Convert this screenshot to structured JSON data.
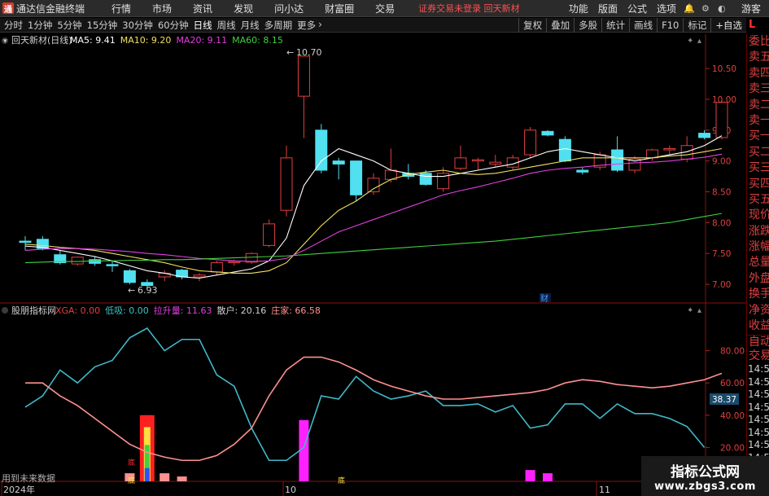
{
  "app": {
    "title": "通达信金融终端",
    "logo_text": "通"
  },
  "menu": [
    "行情",
    "市场",
    "资讯",
    "发现",
    "问小达",
    "财富圈",
    "交易"
  ],
  "notice": "证券交易未登录  回天新材",
  "top_right": {
    "items": [
      "功能",
      "版面",
      "公式",
      "选项"
    ],
    "guest": "游客"
  },
  "periods": [
    "分时",
    "1分钟",
    "5分钟",
    "15分钟",
    "30分钟",
    "60分钟",
    "日线",
    "周线",
    "月线",
    "多周期",
    "更多"
  ],
  "active_period": "日线",
  "toolbar": [
    "复权",
    "叠加",
    "多股",
    "统计",
    "画线",
    "F10",
    "标记",
    "+自选"
  ],
  "L_mark": "L",
  "sidebar": {
    "items": [
      "委比",
      "卖五",
      "卖四",
      "卖三",
      "卖二",
      "卖一",
      "买一",
      "买二",
      "买三",
      "买四",
      "买五",
      "现价",
      "涨跌",
      "涨幅",
      "总量",
      "外盘",
      "换手",
      "净资",
      "收益"
    ],
    "auto": [
      "自动",
      "交易"
    ],
    "times": [
      "14:56",
      "14:56",
      "14:56",
      "14:56",
      "14:56",
      "14:56",
      "14:56",
      "14:56",
      "14:56",
      "14:56"
    ]
  },
  "main_panel": {
    "title": "回天新材(日线)",
    "ma": [
      {
        "label": "MA5: 9.41",
        "color": "#ffffff"
      },
      {
        "label": "MA10: 9.20",
        "color": "#f0e060"
      },
      {
        "label": "MA20: 9.11",
        "color": "#e040e0"
      },
      {
        "label": "MA60: 8.15",
        "color": "#40d040"
      }
    ],
    "high_label": "10.70",
    "low_label": "6.93",
    "finance_marker": "财"
  },
  "sub_panel": {
    "title": "股朋指标网",
    "values": [
      {
        "label": "XGA: 0.00",
        "color": "#e04040"
      },
      {
        "label": "低吸: 0.00",
        "color": "#40c0c0"
      },
      {
        "label": "拉升量: 11.63",
        "color": "#e040e0"
      },
      {
        "label": "散户: 20.16",
        "color": "#d0d0d0"
      },
      {
        "label": "庄家: 66.58",
        "color": "#ff9090"
      }
    ],
    "current_value_tag": "38.37",
    "future_data_note": "用到未来数据",
    "markers": [
      "底",
      "底",
      "底"
    ]
  },
  "x_axis": {
    "labels": [
      "2024年",
      "10",
      "11"
    ]
  },
  "watermark": {
    "line1": "指标公式网",
    "line2": "www.zbgs3.com"
  },
  "chart_data": [
    {
      "type": "candlestick",
      "title": "回天新材(日线)",
      "ylim": [
        6.75,
        10.95
      ],
      "yticks": [
        7.0,
        7.5,
        8.0,
        8.5,
        9.0,
        9.5,
        10.0,
        10.5
      ],
      "up_color": "#e04040",
      "down_color": "#50e0f0",
      "candles": [
        {
          "o": 7.7,
          "h": 7.78,
          "l": 7.55,
          "c": 7.68
        },
        {
          "o": 7.73,
          "h": 7.78,
          "l": 7.55,
          "c": 7.58
        },
        {
          "o": 7.48,
          "h": 7.55,
          "l": 7.32,
          "c": 7.35
        },
        {
          "o": 7.33,
          "h": 7.45,
          "l": 7.3,
          "c": 7.44
        },
        {
          "o": 7.4,
          "h": 7.46,
          "l": 7.3,
          "c": 7.34
        },
        {
          "o": 7.32,
          "h": 7.38,
          "l": 7.2,
          "c": 7.3
        },
        {
          "o": 7.22,
          "h": 7.25,
          "l": 7.0,
          "c": 7.03
        },
        {
          "o": 7.03,
          "h": 7.08,
          "l": 6.93,
          "c": 6.98
        },
        {
          "o": 7.12,
          "h": 7.23,
          "l": 7.05,
          "c": 7.18
        },
        {
          "o": 7.23,
          "h": 7.25,
          "l": 7.08,
          "c": 7.12
        },
        {
          "o": 7.12,
          "h": 7.18,
          "l": 7.05,
          "c": 7.15
        },
        {
          "o": 7.2,
          "h": 7.38,
          "l": 7.15,
          "c": 7.35
        },
        {
          "o": 7.35,
          "h": 7.4,
          "l": 7.3,
          "c": 7.37
        },
        {
          "o": 7.36,
          "h": 7.52,
          "l": 7.33,
          "c": 7.5
        },
        {
          "o": 7.63,
          "h": 8.05,
          "l": 7.6,
          "c": 7.98
        },
        {
          "o": 8.2,
          "h": 9.25,
          "l": 8.1,
          "c": 9.05
        },
        {
          "o": 10.05,
          "h": 10.7,
          "l": 9.37,
          "c": 10.7
        },
        {
          "o": 9.5,
          "h": 9.6,
          "l": 8.8,
          "c": 8.85
        },
        {
          "o": 9.0,
          "h": 9.05,
          "l": 8.7,
          "c": 8.95
        },
        {
          "o": 9.0,
          "h": 9.0,
          "l": 8.35,
          "c": 8.45
        },
        {
          "o": 8.5,
          "h": 8.8,
          "l": 8.45,
          "c": 8.72
        },
        {
          "o": 8.7,
          "h": 9.2,
          "l": 8.65,
          "c": 8.85
        },
        {
          "o": 8.8,
          "h": 8.95,
          "l": 8.7,
          "c": 8.75
        },
        {
          "o": 8.8,
          "h": 8.85,
          "l": 8.6,
          "c": 8.62
        },
        {
          "o": 8.55,
          "h": 8.9,
          "l": 8.5,
          "c": 8.8
        },
        {
          "o": 8.88,
          "h": 9.25,
          "l": 8.85,
          "c": 9.05
        },
        {
          "o": 9.0,
          "h": 9.05,
          "l": 8.85,
          "c": 9.02
        },
        {
          "o": 8.95,
          "h": 9.1,
          "l": 8.9,
          "c": 8.98
        },
        {
          "o": 8.9,
          "h": 9.1,
          "l": 8.85,
          "c": 9.05
        },
        {
          "o": 9.1,
          "h": 9.55,
          "l": 9.05,
          "c": 9.5
        },
        {
          "o": 9.48,
          "h": 9.5,
          "l": 9.4,
          "c": 9.42
        },
        {
          "o": 9.35,
          "h": 9.4,
          "l": 8.98,
          "c": 9.0
        },
        {
          "o": 8.85,
          "h": 8.9,
          "l": 8.78,
          "c": 8.82
        },
        {
          "o": 8.9,
          "h": 9.15,
          "l": 8.85,
          "c": 9.1
        },
        {
          "o": 9.18,
          "h": 9.4,
          "l": 8.82,
          "c": 8.85
        },
        {
          "o": 8.85,
          "h": 9.08,
          "l": 8.8,
          "c": 9.03
        },
        {
          "o": 9.05,
          "h": 9.2,
          "l": 9.0,
          "c": 9.18
        },
        {
          "o": 9.18,
          "h": 9.25,
          "l": 9.1,
          "c": 9.2
        },
        {
          "o": 9.03,
          "h": 9.4,
          "l": 8.98,
          "c": 9.25
        },
        {
          "o": 9.45,
          "h": 9.5,
          "l": 9.35,
          "c": 9.38
        },
        {
          "o": 9.38,
          "h": 10.0,
          "l": 9.35,
          "c": 9.95
        }
      ],
      "ma_series": [
        {
          "name": "MA5",
          "color": "#ffffff",
          "values": [
            7.62,
            7.6,
            7.55,
            7.5,
            7.45,
            7.38,
            7.3,
            7.22,
            7.18,
            7.12,
            7.1,
            7.15,
            7.2,
            7.25,
            7.38,
            7.75,
            8.6,
            9.0,
            9.2,
            9.1,
            9.0,
            8.85,
            8.8,
            8.75,
            8.75,
            8.8,
            8.85,
            8.9,
            8.95,
            9.05,
            9.15,
            9.2,
            9.15,
            9.1,
            9.05,
            9.0,
            9.05,
            9.1,
            9.15,
            9.25,
            9.41
          ]
        },
        {
          "name": "MA10",
          "color": "#f0e060",
          "values": [
            7.65,
            7.63,
            7.6,
            7.58,
            7.55,
            7.5,
            7.45,
            7.4,
            7.35,
            7.28,
            7.22,
            7.2,
            7.18,
            7.18,
            7.22,
            7.35,
            7.65,
            7.95,
            8.2,
            8.35,
            8.55,
            8.7,
            8.78,
            8.82,
            8.85,
            8.8,
            8.78,
            8.8,
            8.85,
            8.9,
            8.95,
            9.0,
            9.05,
            9.05,
            9.05,
            9.05,
            9.05,
            9.08,
            9.1,
            9.15,
            9.2
          ]
        },
        {
          "name": "MA20",
          "color": "#e040e0",
          "values": [
            7.55,
            7.57,
            7.58,
            7.58,
            7.57,
            7.55,
            7.53,
            7.5,
            7.48,
            7.45,
            7.42,
            7.4,
            7.38,
            7.37,
            7.38,
            7.42,
            7.55,
            7.7,
            7.85,
            7.95,
            8.05,
            8.15,
            8.25,
            8.35,
            8.45,
            8.52,
            8.58,
            8.65,
            8.72,
            8.8,
            8.85,
            8.88,
            8.9,
            8.93,
            8.95,
            8.97,
            8.98,
            9.0,
            9.03,
            9.06,
            9.11
          ]
        },
        {
          "name": "MA60",
          "color": "#40d040",
          "values": [
            7.35,
            7.36,
            7.37,
            7.37,
            7.38,
            7.38,
            7.39,
            7.39,
            7.4,
            7.4,
            7.41,
            7.42,
            7.43,
            7.44,
            7.45,
            7.46,
            7.48,
            7.5,
            7.52,
            7.54,
            7.56,
            7.58,
            7.6,
            7.62,
            7.64,
            7.66,
            7.68,
            7.7,
            7.73,
            7.76,
            7.79,
            7.82,
            7.85,
            7.88,
            7.91,
            7.94,
            7.97,
            8.0,
            8.05,
            8.1,
            8.15
          ]
        }
      ]
    },
    {
      "type": "line",
      "title": "股朋指标网",
      "ylim": [
        0,
        100
      ],
      "yticks": [
        20.0,
        40.0,
        60.0,
        80.0
      ],
      "series": [
        {
          "name": "散户",
          "color": "#40b8c8",
          "values": [
            45,
            52,
            68,
            60,
            70,
            74,
            88,
            94,
            80,
            87,
            87,
            65,
            58,
            32,
            12,
            12,
            20,
            52,
            50,
            64,
            55,
            50,
            52,
            55,
            46,
            46,
            47,
            42,
            46,
            32,
            34,
            47,
            47,
            38,
            47,
            41,
            41,
            38,
            33,
            20
          ]
        },
        {
          "name": "庄家",
          "color": "#ff9090",
          "values": [
            60,
            60,
            52,
            46,
            38,
            30,
            22,
            17,
            14,
            12,
            12,
            15,
            22,
            32,
            52,
            68,
            76,
            76,
            73,
            68,
            62,
            58,
            55,
            52,
            50,
            50,
            51,
            52,
            53,
            54,
            56,
            60,
            62,
            61,
            59,
            58,
            57,
            58,
            60,
            62,
            66
          ]
        }
      ],
      "bars": [
        {
          "index": 6,
          "value": 4,
          "color": "#ff9090"
        },
        {
          "index": 7,
          "value": 40,
          "color": "#ff2020"
        },
        {
          "index": 8,
          "value": 4,
          "color": "#ff9090"
        },
        {
          "index": 9,
          "value": 2,
          "color": "#ff9090"
        },
        {
          "index": 16,
          "value": 37,
          "color": "#ff20ff"
        },
        {
          "index": 29,
          "value": 6,
          "color": "#ff20ff"
        },
        {
          "index": 30,
          "value": 4,
          "color": "#ff20ff"
        },
        {
          "index": 40,
          "value": 11.63,
          "color": "#ff20ff"
        }
      ]
    }
  ]
}
